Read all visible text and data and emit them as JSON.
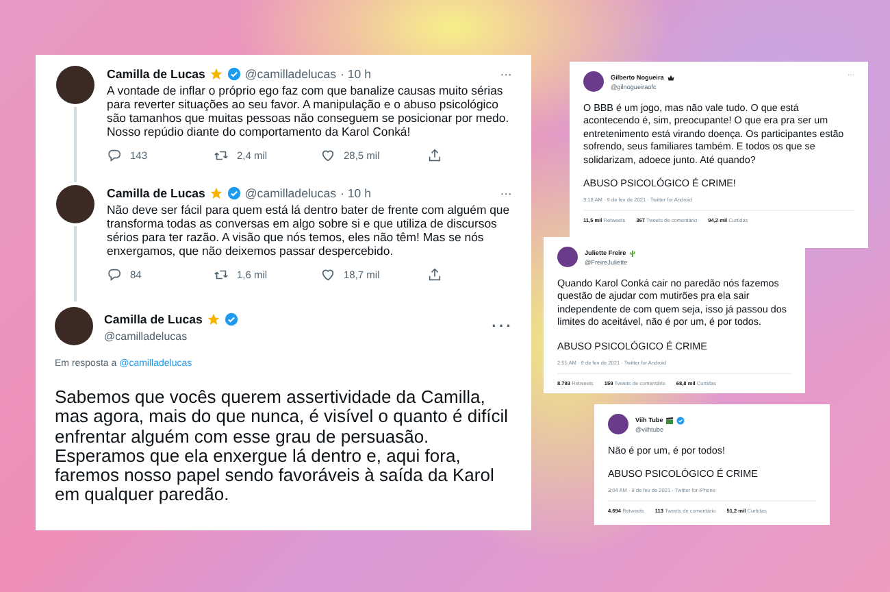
{
  "thread": [
    {
      "name": "Camilla de Lucas",
      "star": true,
      "verified": true,
      "handle": "@camilladelucas",
      "time": "· 10 h",
      "more": "···",
      "text": "A vontade de inflar o próprio ego faz com que banalize causas muito sérias para reverter situações ao seu favor. A manipulação e o abuso psicológico são tamanhos que muitas pessoas não conseguem se posicionar por medo. Nosso repúdio diante do comportamento da Karol Conká!",
      "replies": "143",
      "retweets": "2,4 mil",
      "likes": "28,5 mil"
    },
    {
      "name": "Camilla de Lucas",
      "star": true,
      "verified": true,
      "handle": "@camilladelucas",
      "time": "· 10 h",
      "more": "···",
      "text": "Não deve ser fácil para quem está lá dentro bater de frente com alguém que transforma todas as conversas em algo sobre si e que utiliza de discursos sérios para ter razão. A visão que nós temos, eles não têm! Mas se nós enxergamos, que não deixemos passar despercebido.",
      "replies": "84",
      "retweets": "1,6 mil",
      "likes": "18,7 mil"
    },
    {
      "name": "Camilla de Lucas",
      "star": true,
      "verified": true,
      "handle": "@camilladelucas",
      "more": "···",
      "reply_label": "Em resposta a",
      "reply_handle": "@camilladelucas",
      "text": "Sabemos que vocês querem assertividade da Camilla, mas agora, mais do que nunca, é visível o quanto é difícil enfrentar alguém com esse grau de persuasão. Esperamos que ela enxergue lá dentro e, aqui fora, faremos nosso papel sendo favoráveis à saída da Karol em qualquer paredão."
    }
  ],
  "cards": [
    {
      "name": "Gilberto Nogueira",
      "crown": true,
      "handle": "@gilnogueiraofc",
      "more": "···",
      "text": "O BBB é um jogo, mas não vale tudo. O que está acontecendo é, sim, preocupante! O que era pra ser um entretenimento está virando doença. Os participantes estão sofrendo, seus familiares também. E todos os que se solidarizam, adoece junto. Até quando?",
      "tagline": "ABUSO PSICOLÓGICO É CRIME!",
      "meta": "3:18 AM · 9 de fev de 2021 · Twitter for Android",
      "stats": [
        {
          "value": "11,5 mil",
          "label": "Retweets"
        },
        {
          "value": "367",
          "label": "Tweets de comentário"
        },
        {
          "value": "94,2 mil",
          "label": "Curtidas"
        }
      ]
    },
    {
      "name": "Juliette Freire",
      "cactus": true,
      "handle": "@FreireJuliette",
      "text": "Quando Karol Conká cair no paredão nós fazemos questão de ajudar com mutirões pra ela sair independente de com quem seja, isso já passou dos limites do aceitável, não é por um, é por todos.",
      "tagline": "ABUSO PSICOLÓGICO É CRIME",
      "meta": "2:55 AM · 9 de fev de 2021 · Twitter for Android",
      "stats": [
        {
          "value": "8.793",
          "label": "Retweets"
        },
        {
          "value": "159",
          "label": "Tweets de comentário"
        },
        {
          "value": "68,8 mil",
          "label": "Curtidas"
        }
      ]
    },
    {
      "name": "Viih Tube",
      "clapperboard": true,
      "verified": true,
      "handle": "@viihtube",
      "text": "Não é por um, é por todos!",
      "tagline": "ABUSO PSICOLÓGICO É CRIME",
      "meta": "3:04 AM · 9 de fev de 2021 · Twitter for iPhone",
      "stats": [
        {
          "value": "4.694",
          "label": "Retweets"
        },
        {
          "value": "113",
          "label": "Tweets de comentário"
        },
        {
          "value": "51,2 mil",
          "label": "Curtidas"
        }
      ]
    }
  ]
}
